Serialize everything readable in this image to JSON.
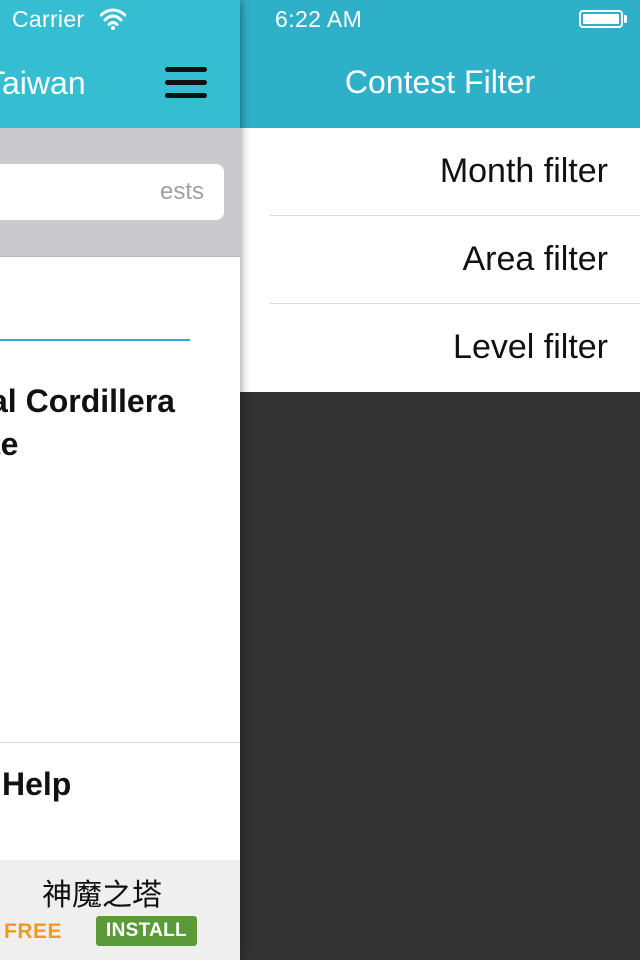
{
  "status_bar": {
    "carrier": "Carrier",
    "time": "6:22 AM",
    "icons": [
      "wifi-icon",
      "battery-icon"
    ]
  },
  "main": {
    "header_title": "Taiwan",
    "menu_icon": "hamburger-menu-icon",
    "search": {
      "placeholder": "ests"
    },
    "card": {
      "title_line1": "al Cordillera",
      "title_line2": "te"
    },
    "help_label": "Help"
  },
  "ad": {
    "title": "神魔之塔",
    "free_label": "FREE",
    "install_label": "INSTALL"
  },
  "filter_panel": {
    "title": "Contest Filter",
    "items": [
      {
        "label": "Month filter"
      },
      {
        "label": "Area filter"
      },
      {
        "label": "Level filter"
      }
    ]
  },
  "colors": {
    "main_header": "#35bdd2",
    "filter_header": "#2fb0c9",
    "search_area": "#c9c9ce",
    "drawer_background": "#333333",
    "accent_underline": "#39a3dc",
    "ad_free": "#f29a1d",
    "ad_install": "#5a9a38"
  }
}
